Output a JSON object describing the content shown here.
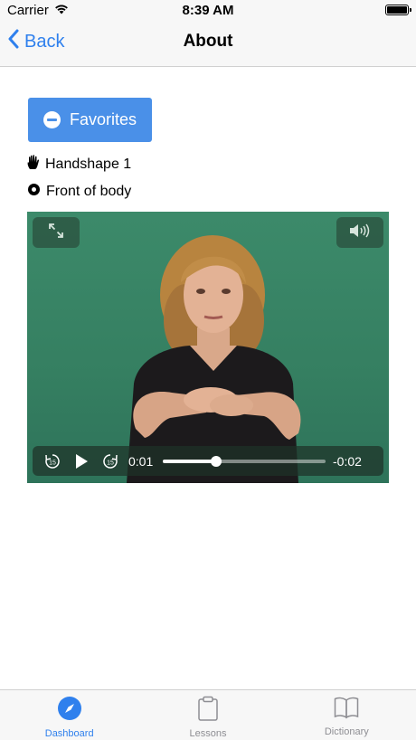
{
  "status_bar": {
    "carrier": "Carrier",
    "time": "8:39 AM",
    "battery_level": 1.0
  },
  "nav": {
    "back_label": "Back",
    "title": "About"
  },
  "favorites_button": {
    "label": "Favorites"
  },
  "details": {
    "handshape": "Handshape 1",
    "location": "Front of body"
  },
  "video": {
    "current_time": "0:01",
    "remaining_time": "-0:02",
    "progress": 0.33
  },
  "tabs": [
    {
      "label": "Dashboard",
      "icon": "compass-icon",
      "active": true
    },
    {
      "label": "Lessons",
      "icon": "clipboard-icon",
      "active": false
    },
    {
      "label": "Dictionary",
      "icon": "book-icon",
      "active": false
    }
  ],
  "colors": {
    "accent": "#2f80ed",
    "button": "#4a90e8",
    "video_bg": "#3c8a6a"
  }
}
